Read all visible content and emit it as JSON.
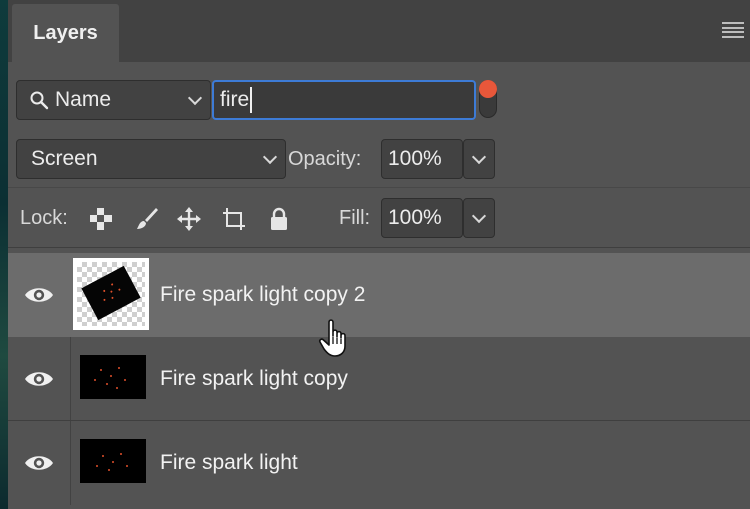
{
  "panel": {
    "tab_label": "Layers",
    "menu_icon": "panel-menu-icon"
  },
  "filter": {
    "type_icon": "search-icon",
    "type_label": "Name",
    "query_value": "fire",
    "toggle_color": "#e8573a"
  },
  "blend": {
    "mode_value": "Screen",
    "opacity_label": "Opacity:",
    "opacity_value": "100%"
  },
  "lock": {
    "label": "Lock:",
    "icons": [
      "lock-transparent-pixels-icon",
      "lock-image-pixels-icon",
      "lock-position-icon",
      "artboard-autonest-icon",
      "lock-all-icon"
    ],
    "fill_label": "Fill:",
    "fill_value": "100%"
  },
  "layers": [
    {
      "name": "Fire spark light copy 2",
      "selected": true,
      "visible": true
    },
    {
      "name": "Fire spark light copy",
      "selected": false,
      "visible": true
    },
    {
      "name": "Fire spark light",
      "selected": false,
      "visible": true
    }
  ],
  "colors": {
    "panel_bg": "#535353",
    "selected_row": "#6c6c6c",
    "focus_ring": "#3d7bd6"
  }
}
